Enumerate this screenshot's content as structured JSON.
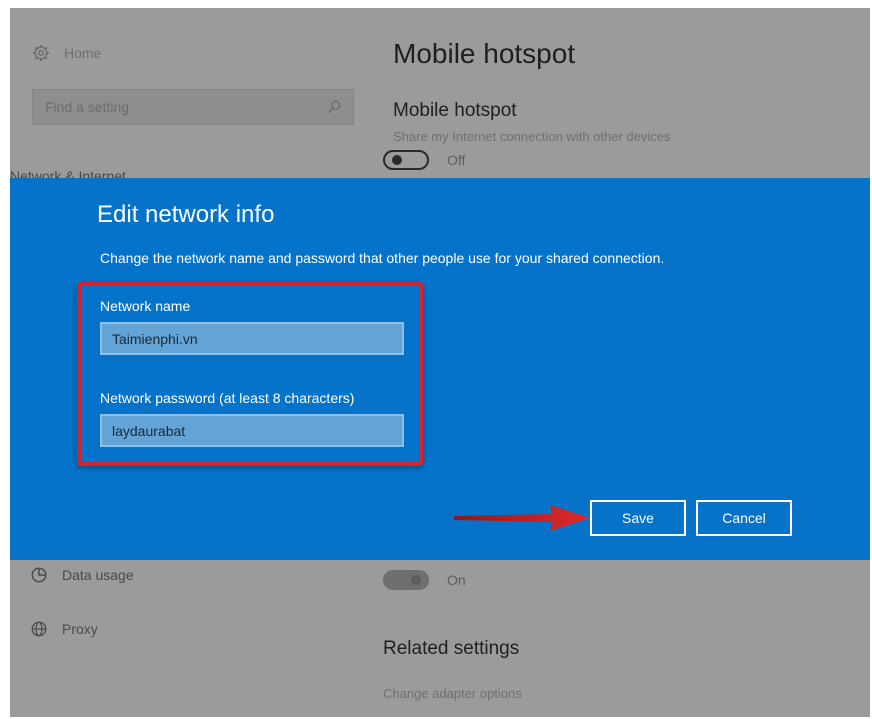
{
  "background": {
    "sidebar": {
      "home_label": "Home",
      "search_placeholder": "Find a setting",
      "section_label": "Network & Internet",
      "items": [
        {
          "label": "Data usage",
          "icon": "data-usage-icon"
        },
        {
          "label": "Proxy",
          "icon": "globe-icon"
        }
      ]
    },
    "main": {
      "title": "Mobile hotspot",
      "hotspot_heading": "Mobile hotspot",
      "hotspot_desc": "Share my Internet connection with other devices",
      "hotspot_toggle_state": "Off",
      "second_toggle_state": "On",
      "related_title": "Related settings",
      "related_link": "Change adapter options"
    }
  },
  "dialog": {
    "title": "Edit network info",
    "description": "Change the network name and password that other people use for your shared connection.",
    "network_name_label": "Network name",
    "network_name_value": "Taimienphi.vn",
    "password_label": "Network password (at least 8 characters)",
    "password_value": "laydaurabat",
    "save_label": "Save",
    "cancel_label": "Cancel"
  },
  "colors": {
    "dialog_bg": "#0473c9",
    "highlight_border": "#d4242e",
    "arrow": "#d4242e",
    "overlay_bg": "#9b9b9b"
  }
}
